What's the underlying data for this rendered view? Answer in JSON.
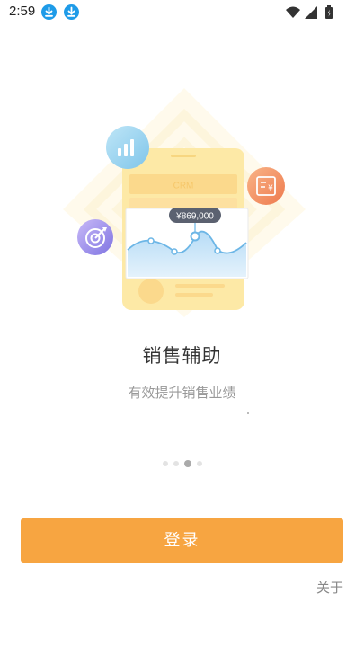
{
  "status_bar": {
    "time": "2:59",
    "notification_icons": [
      "download-icon",
      "download-icon"
    ],
    "system_icons": [
      "wifi-icon",
      "cellular-signal-icon",
      "battery-icon"
    ]
  },
  "illustration": {
    "phone_header_text": "CRM",
    "price_badge": "¥869,000",
    "floating_icons": [
      "bar-chart-icon",
      "target-icon",
      "invoice-icon"
    ],
    "colors": {
      "phone": "#fde9a6",
      "badge": "#5b6170",
      "line": "#6cb6e6",
      "bar_icon": "#9fd6ee",
      "target_icon": "#9f8fe6",
      "invoice_icon": "#f2885a"
    }
  },
  "page": {
    "title": "销售辅助",
    "subtitle": "有效提升销售业绩"
  },
  "pager": {
    "count": 4,
    "active_index": 2
  },
  "actions": {
    "login_label": "登录",
    "about_label": "关于"
  },
  "colors": {
    "accent": "#f7a541",
    "title_text": "#333333",
    "subtitle_text": "#999999"
  }
}
